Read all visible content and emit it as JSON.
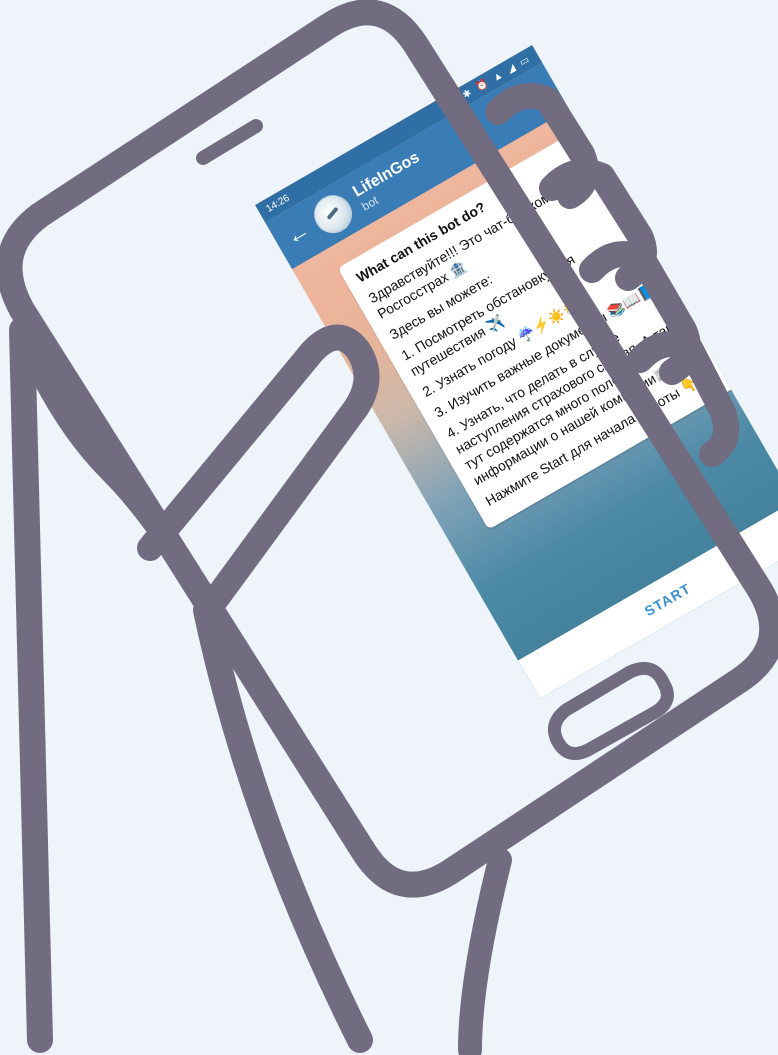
{
  "colors": {
    "frame": "#716c80",
    "background": "#eef4fa",
    "header": "#3a7cb5",
    "statusbar": "#2f6fa6",
    "start": "#3a8fd0"
  },
  "status_bar": {
    "time": "14:26",
    "icons": "... ✱ ⏰ ▲ ◢ ▭"
  },
  "header": {
    "back_icon": "arrow-left-icon",
    "back_glyph": "←",
    "title": "LifeInGos",
    "subtitle": "bot",
    "menu_icon": "more-vertical-icon",
    "menu_glyph": "⋮"
  },
  "message": {
    "title": "What can this bot do?",
    "paragraphs": [
      "Здравствуйте!!! Это чат-бот компании Росгосстрах 🏦",
      "Здесь вы можете:",
      "1. Посмотреть обстановку для путешествия ✈️",
      "2. Узнать погоду ☔⚡☀️⛅",
      "3. Изучить важные документы 📚📖📘",
      "4. Узнать, что делать в случае наступления страхового случая. А также тут содержатся много полезной информации о нашей компании📰📊",
      "Нажмите Start для начала работы 👇"
    ]
  },
  "footer": {
    "start_label": "START"
  }
}
